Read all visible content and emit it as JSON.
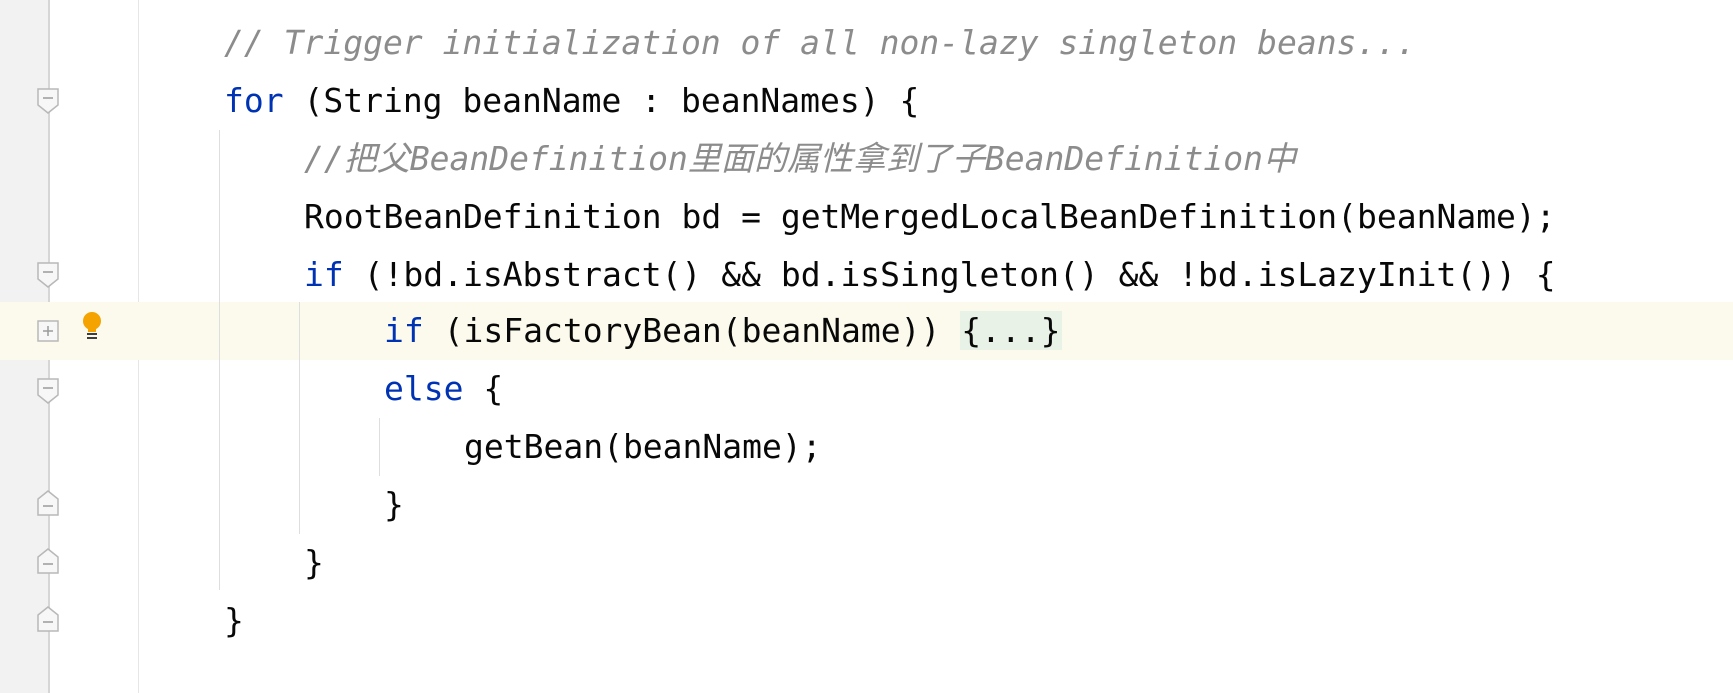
{
  "code": {
    "comment_trigger": "// Trigger initialization of all non-lazy singleton beans...",
    "for_keyword": "for",
    "for_rest": " (String beanName : beanNames) {",
    "comment_cn": "//把父BeanDefinition里面的属性拿到了子BeanDefinition中",
    "root_def": "RootBeanDefinition bd = getMergedLocalBeanDefinition(beanName);",
    "if1_keyword": "if",
    "if1_rest": " (!bd.isAbstract() && bd.isSingleton() && !bd.isLazyInit()) {",
    "if2_keyword": "if",
    "if2_rest": " (isFactoryBean(beanName)) ",
    "folded_block": "{...}",
    "else_keyword": "else",
    "else_rest": " {",
    "get_bean": "getBean(beanName);",
    "close_brace": "}"
  },
  "icons": {
    "bulb": "intention-bulb-icon",
    "fold": "fold-marker-icon",
    "unfold": "unfold-marker-icon"
  },
  "colors": {
    "keyword": "#0033b3",
    "comment": "#8c8c8c",
    "text": "#080808",
    "current_line": "#fcfaed",
    "folded_bg": "#e8f2e6",
    "bulb": "#f4a300"
  }
}
